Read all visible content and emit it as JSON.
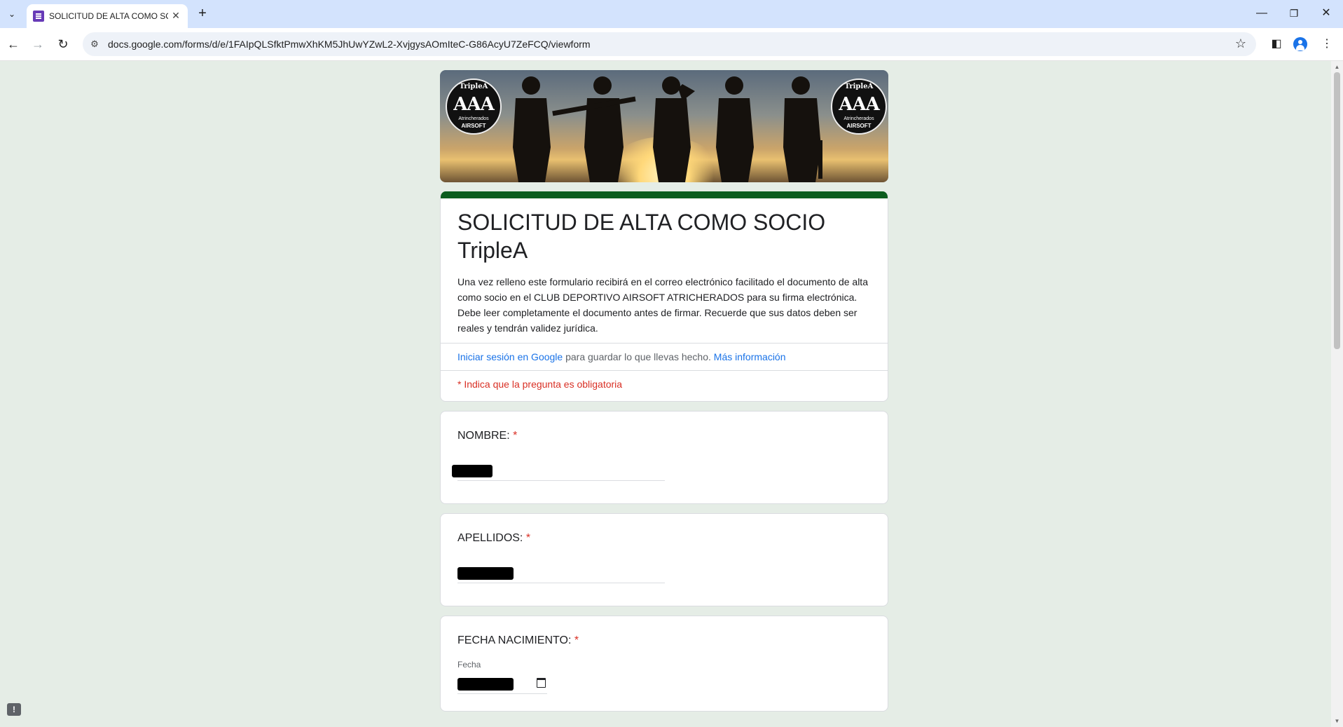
{
  "browser": {
    "tab_title": "SOLICITUD DE ALTA COMO SOCIO TripleA",
    "url": "docs.google.com/forms/d/e/1FAIpQLSfktPmwXhKM5JhUwYZwL2-XvjgysAOmIteC-G86AcyU7ZeFCQ/viewform",
    "icons": [
      "tab-list-icon",
      "forms-favicon",
      "close-icon",
      "plus-icon",
      "minimize-icon",
      "restore-icon",
      "close-window-icon",
      "back-icon",
      "forward-icon",
      "reload-icon",
      "site-info-icon",
      "star-icon",
      "side-panel-icon",
      "profile-icon",
      "menu-icon"
    ]
  },
  "banner": {
    "logo_top": "TripleA",
    "logo_main": "AAA",
    "logo_sub1": "Atrincherados",
    "logo_sub2": "AIRSOFT"
  },
  "form": {
    "accent_color": "#0b5d1e",
    "title": "SOLICITUD DE ALTA COMO SOCIO TripleA",
    "description": "Una vez relleno este formulario recibirá en el correo electrónico facilitado el documento de alta como socio en el CLUB DEPORTIVO AIRSOFT ATRICHERADOS para su firma electrónica. Debe leer completamente el documento antes de firmar. Recuerde que sus datos deben ser reales y tendrán validez jurídica.",
    "signin_link": "Iniciar sesión en Google",
    "signin_text": " para guardar lo que llevas hecho. ",
    "more_info": "Más información",
    "required_note": "* Indica que la pregunta es obligatoria",
    "questions": [
      {
        "label": "NOMBRE:",
        "required": "*"
      },
      {
        "label": "APELLIDOS:",
        "required": "*"
      },
      {
        "label": "FECHA NACIMIENTO:",
        "required": "*",
        "sublabel": "Fecha"
      }
    ]
  }
}
